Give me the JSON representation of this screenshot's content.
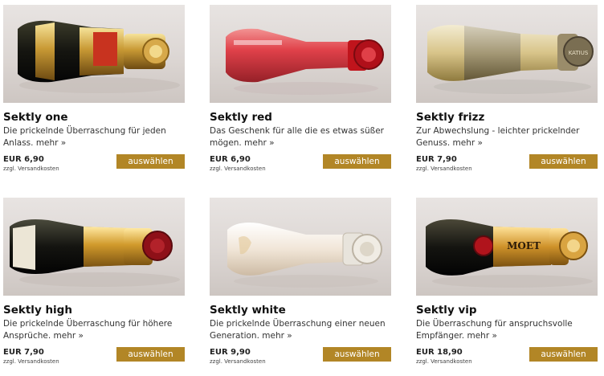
{
  "products": [
    {
      "name": "Sektly one",
      "desc": "Die prickelnde Überraschung für jeden Anlass.",
      "more": "mehr »",
      "price": "EUR 6,90",
      "shipping": "zzgl. Versandkosten",
      "button": "auswählen",
      "image": "bottle-gold-label"
    },
    {
      "name": "Sektly red",
      "desc": "Das Geschenk für alle die es etwas süßer mögen.",
      "more": "mehr »",
      "price": "EUR 6,90",
      "shipping": "zzgl. Versandkosten",
      "button": "auswählen",
      "image": "bottle-red"
    },
    {
      "name": "Sektly frizz",
      "desc": "Zur Abwechslung - leichter prickelnder Genuss.",
      "more": "mehr »",
      "price": "EUR 7,90",
      "shipping": "zzgl. Versandkosten",
      "button": "auswählen",
      "image": "bottle-clear-gold"
    },
    {
      "name": "Sektly high",
      "desc": "Die prickelnde Überraschung für höhere Ansprüche.",
      "more": "mehr »",
      "price": "EUR 7,90",
      "shipping": "zzgl. Versandkosten",
      "button": "auswählen",
      "image": "bottle-dark-gold"
    },
    {
      "name": "Sektly white",
      "desc": "Die prickelnde Überraschung einer neuen Generation.",
      "more": "mehr »",
      "price": "EUR 9,90",
      "shipping": "zzgl. Versandkosten",
      "button": "auswählen",
      "image": "bottle-white"
    },
    {
      "name": "Sektly vip",
      "desc": "Die Überraschung für anspruchsvolle Empfänger.",
      "more": "mehr »",
      "price": "EUR 18,90",
      "shipping": "zzgl. Versandkosten",
      "button": "auswählen",
      "image": "bottle-moet"
    }
  ],
  "bottle_labels": {
    "vip": "MOET",
    "frizz": "KATIUS"
  },
  "colors": {
    "button": "#b28626",
    "button_text": "#ffffff"
  }
}
